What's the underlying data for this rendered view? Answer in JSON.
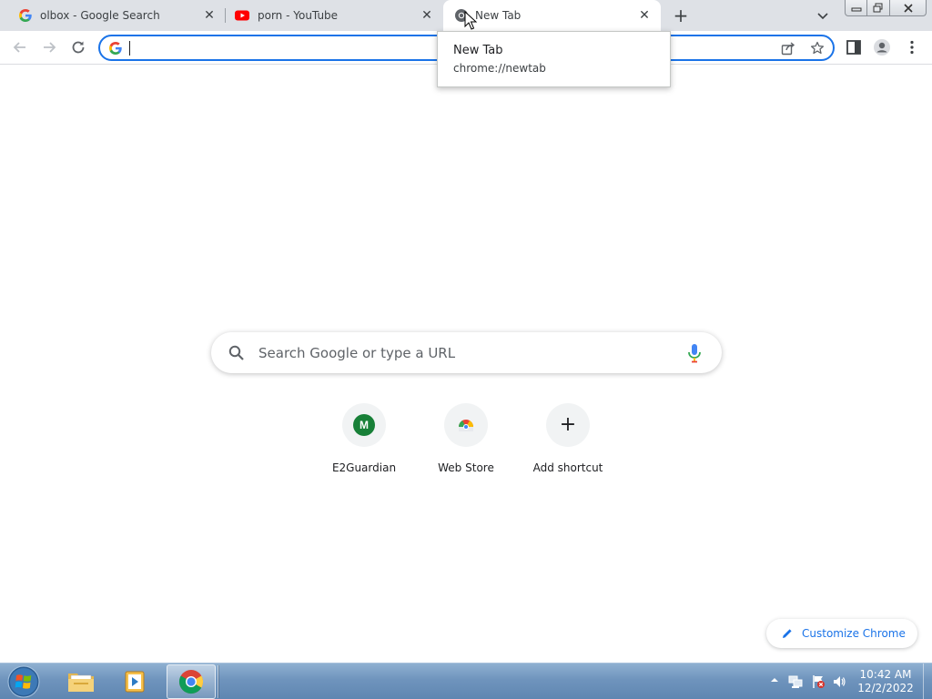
{
  "tabs": [
    {
      "title": "olbox - Google Search",
      "favicon": "google-icon"
    },
    {
      "title": "porn - YouTube",
      "favicon": "youtube-icon"
    },
    {
      "title": "New Tab",
      "favicon": "chrome-icon",
      "active": true
    }
  ],
  "hover_card": {
    "title": "New Tab",
    "url": "chrome://newtab"
  },
  "omnibox": {
    "value": ""
  },
  "ntp": {
    "search_placeholder": "Search Google or type a URL",
    "shortcuts": [
      {
        "label": "E2Guardian",
        "icon_letter": "M",
        "icon_color": "#188038"
      },
      {
        "label": "Web Store"
      },
      {
        "label": "Add shortcut"
      }
    ],
    "customize_label": "Customize Chrome"
  },
  "taskbar": {
    "clock_time": "10:42 AM",
    "clock_date": "12/2/2022"
  },
  "colors": {
    "accent": "#1a73e8",
    "tabstrip": "#dee1e6",
    "taskbar": "#6f94bd"
  }
}
